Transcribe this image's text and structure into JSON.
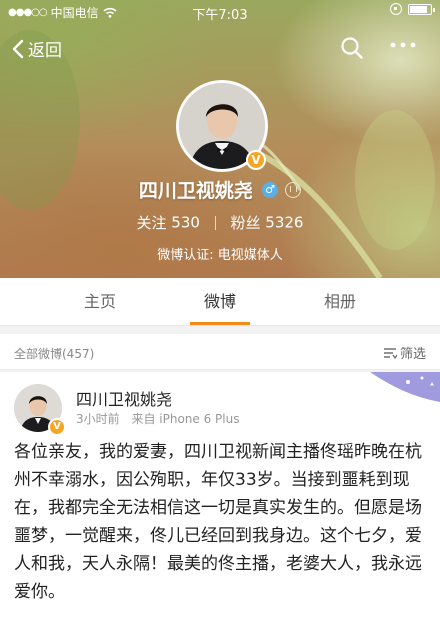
{
  "status_bar": {
    "carrier": "中国电信",
    "time": "下午7:03",
    "battery_level": 0.85
  },
  "nav": {
    "back_label": "返回"
  },
  "profile": {
    "name": "四川卫视姚尧",
    "gender": "♂",
    "following_label": "关注",
    "following_count": "530",
    "followers_label": "粉丝",
    "followers_count": "5326",
    "certification": "微博认证: 电视媒体人",
    "verified_badge": "V"
  },
  "tabs": [
    {
      "label": "主页",
      "active": false
    },
    {
      "label": "微博",
      "active": true
    },
    {
      "label": "相册",
      "active": false
    }
  ],
  "filter": {
    "count_text": "全部微博(457)",
    "filter_label": "筛选"
  },
  "post": {
    "author": "四川卫视姚尧",
    "time": "3小时前",
    "source": "来自 iPhone 6 Plus",
    "badge": "V",
    "text": "各位亲友，我的爱妻，四川卫视新闻主播佟瑶昨晚在杭州不幸溺水，因公殉职，年仅33岁。当接到噩耗到现在，我都完全无法相信这一切是真实发生的。但愿是场噩梦，一觉醒来，佟儿已经回到我身边。这个七夕，爱人和我，天人永隔！最美的佟主播，老婆大人，我永远爱你。"
  },
  "colors": {
    "accent": "#f28a1c",
    "verified": "#f5a623",
    "gender_male": "#5ab0e6"
  }
}
